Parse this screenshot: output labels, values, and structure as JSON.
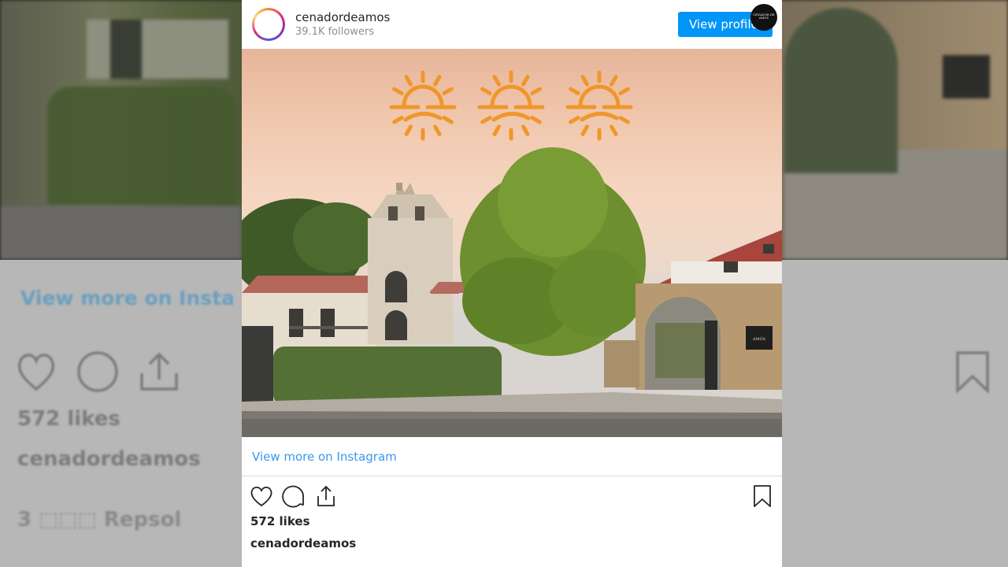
{
  "background": {
    "view_more_text": "View more on Insta",
    "likes_text": "572 likes",
    "username_text": "cenadordeamos",
    "repsol_text": "3 ⬚⬚⬚ Repsol"
  },
  "post": {
    "username": "cenadordeamos",
    "followers": "39.1K followers",
    "view_profile_label": "View profile",
    "brand_logo_text": "CENADOR DE AMÓS",
    "plaque_text": "AMÓS",
    "view_more_label": "View more on Instagram",
    "likes": "572 likes",
    "caption_username": "cenadordeamos"
  },
  "icons": {
    "heart": "heart-icon",
    "comment": "comment-icon",
    "share": "share-icon",
    "bookmark": "bookmark-icon",
    "sun": "sun-icon"
  },
  "colors": {
    "accent": "#0095f6",
    "link": "#3897f0",
    "sun": "#f0962a"
  }
}
